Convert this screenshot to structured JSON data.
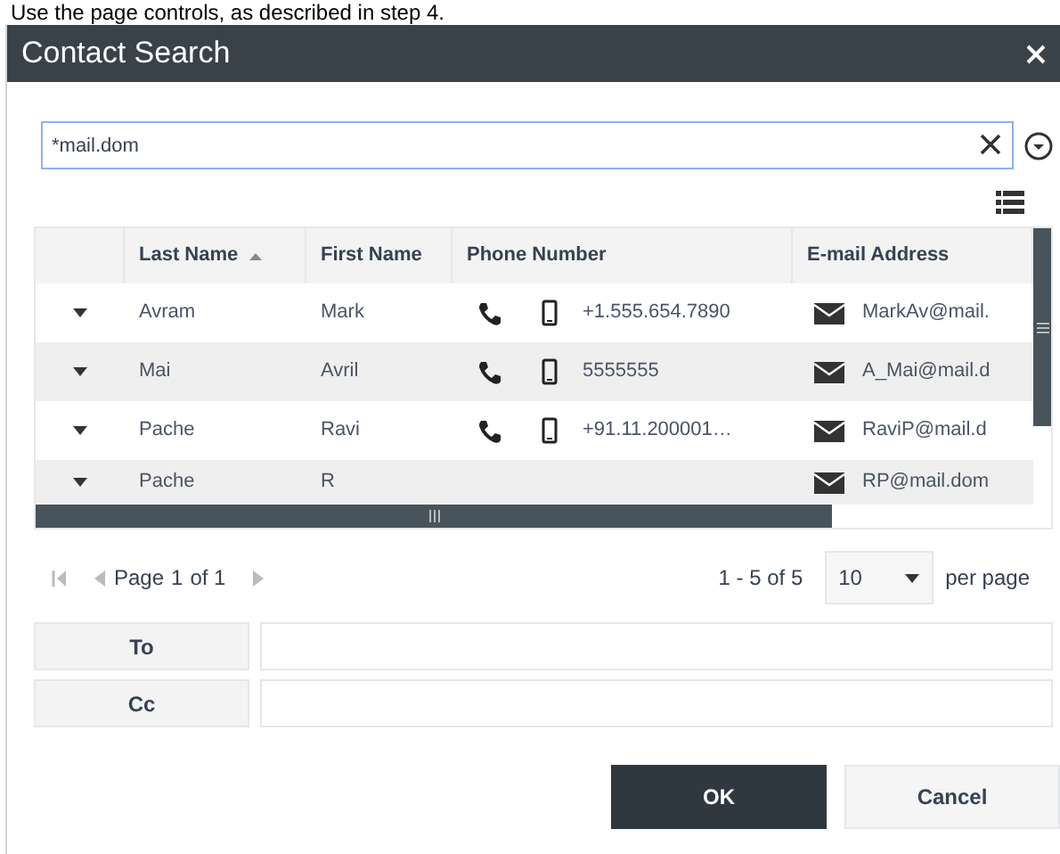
{
  "caption": "Use the page controls, as described in step 4.",
  "dialog": {
    "title": "Contact Search",
    "search": {
      "value": "*mail.dom"
    }
  },
  "table": {
    "columns": [
      {
        "label": "Last Name",
        "sorted": true
      },
      {
        "label": "First Name",
        "sorted": false
      },
      {
        "label": "Phone Number",
        "sorted": false
      },
      {
        "label": "E-mail Address",
        "sorted": false
      }
    ],
    "rows": [
      {
        "last_name": "Avram",
        "first_name": "Mark",
        "has_phone": true,
        "phone": "+1.555.654.7890",
        "email": "MarkAv@mail."
      },
      {
        "last_name": "Mai",
        "first_name": "Avril",
        "has_phone": true,
        "phone": "5555555",
        "email": "A_Mai@mail.d"
      },
      {
        "last_name": "Pache",
        "first_name": "Ravi",
        "has_phone": true,
        "phone": "+91.11.200001…",
        "email": "RaviP@mail.d"
      },
      {
        "last_name": "Pache",
        "first_name": "R",
        "has_phone": false,
        "email": "RP@mail.dom"
      }
    ]
  },
  "pager": {
    "page_label": "Page",
    "page": "1",
    "of_label": "of 1",
    "range": "1 - 5 of 5",
    "page_size": "10",
    "per_page": "per page"
  },
  "recipients": [
    {
      "label": "To"
    },
    {
      "label": "Cc"
    }
  ],
  "buttons": [
    {
      "label": "OK",
      "kind": "primary"
    },
    {
      "label": "Cancel",
      "kind": "secondary"
    }
  ]
}
